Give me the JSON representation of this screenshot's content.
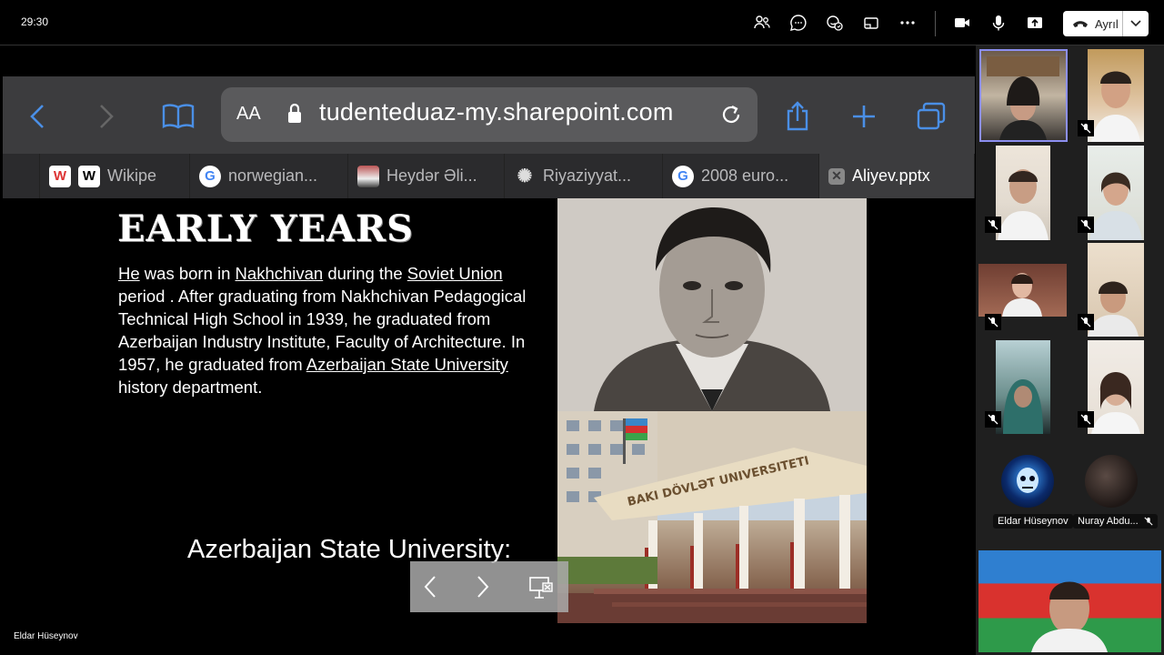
{
  "meeting": {
    "timer": "29:30",
    "leave_label": "Ayrıl",
    "presenter_name": "Eldar Hüseynov"
  },
  "toolbar_icons": [
    "participants-icon",
    "chat-icon",
    "reactions-icon",
    "share-tray-icon",
    "more-icon",
    "camera-icon",
    "mic-icon",
    "share-screen-icon"
  ],
  "browser": {
    "aa_label": "AA",
    "url": "tudenteduaz-my.sharepoint.com",
    "tabs": [
      {
        "label": "Wikipe",
        "icon": "wikipedia-icon"
      },
      {
        "label": "norwegian...",
        "icon": "google-icon"
      },
      {
        "label": "Heydər Əli...",
        "icon": "portrait-favicon-icon"
      },
      {
        "label": "Riyaziyyat...",
        "icon": "gear-favicon-icon"
      },
      {
        "label": "2008 euro...",
        "icon": "google-icon"
      },
      {
        "label": "Aliyev.pptx",
        "icon": "close-tab-icon"
      }
    ]
  },
  "slide": {
    "title": "EARLY YEARS",
    "body_parts": {
      "he": "He",
      "t1": " was born in ",
      "nakh": "Nakhchivan",
      "t2": " during the ",
      "soviet": "Soviet Union",
      "t3": " period . After graduating from Nakhchivan Pedagogical Technical High School in 1939, he graduated from Azerbaijan Industry Institute, Faculty of Architecture. In 1957, he graduated from ",
      "asu": "Azerbaijan State University",
      "t4": " history department."
    },
    "caption": "Azerbaijan State University:",
    "building_sign": "BAKI DÖVLƏT UNIVERSITETI"
  },
  "participants": {
    "named": [
      "Eldar Hüseynov",
      "Nuray Abdu..."
    ]
  }
}
